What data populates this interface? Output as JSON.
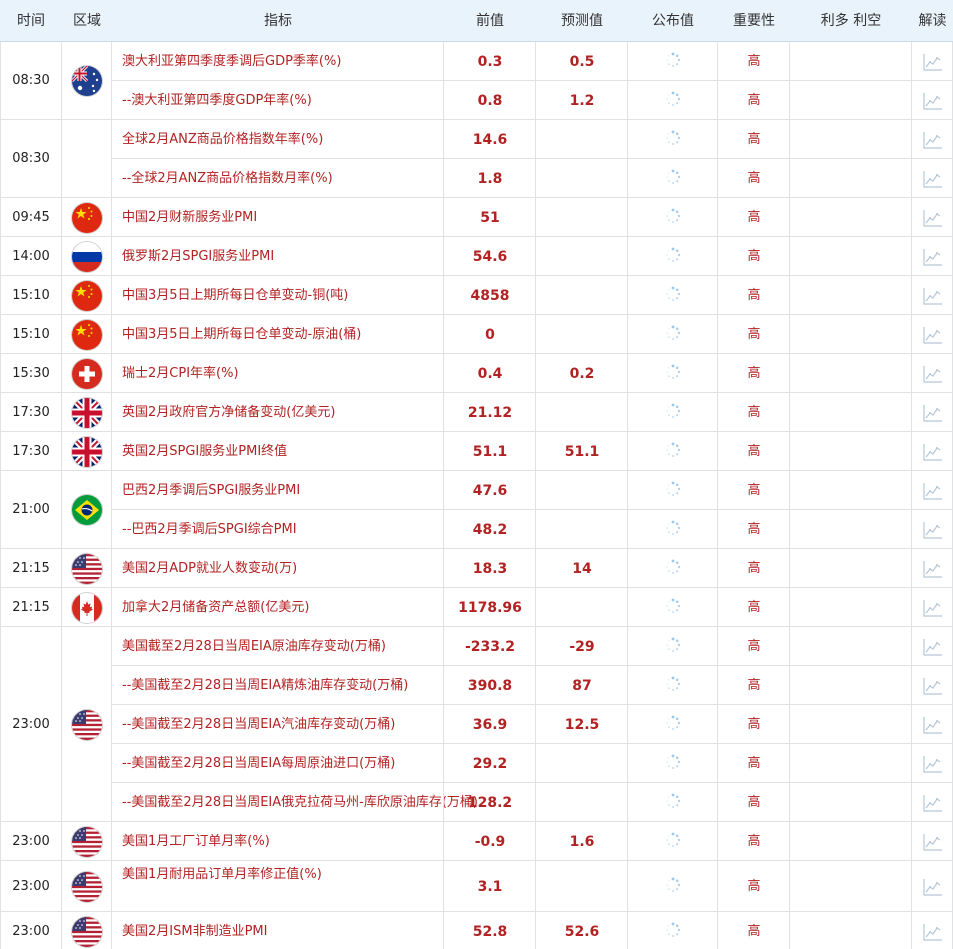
{
  "headers": {
    "time": "时间",
    "region": "区域",
    "indicator": "指标",
    "previous": "前值",
    "forecast": "预测值",
    "actual": "公布值",
    "importance": "重要性",
    "impact": "利多 利空",
    "analysis": "解读"
  },
  "colors": {
    "accent_red": "#b22222",
    "header_bg": "#e9f3fb",
    "grid": "#dfe1e3"
  },
  "groups": [
    {
      "time": "08:30",
      "flag": "australia-flag",
      "rows": [
        {
          "name": "澳大利亚第四季度季调后GDP季率(%)",
          "previous": "0.3",
          "forecast": "0.5",
          "importance": "高"
        },
        {
          "name": "--澳大利亚第四季度GDP年率(%)",
          "previous": "0.8",
          "forecast": "1.2",
          "importance": "高"
        }
      ]
    },
    {
      "time": "08:30",
      "flag": "",
      "rows": [
        {
          "name": "全球2月ANZ商品价格指数年率(%)",
          "previous": "14.6",
          "forecast": "",
          "importance": "高"
        },
        {
          "name": "--全球2月ANZ商品价格指数月率(%)",
          "previous": "1.8",
          "forecast": "",
          "importance": "高"
        }
      ]
    },
    {
      "time": "09:45",
      "flag": "china-flag",
      "rows": [
        {
          "name": "中国2月财新服务业PMI",
          "previous": "51",
          "forecast": "",
          "importance": "高"
        }
      ]
    },
    {
      "time": "14:00",
      "flag": "russia-flag",
      "rows": [
        {
          "name": "俄罗斯2月SPGI服务业PMI",
          "previous": "54.6",
          "forecast": "",
          "importance": "高"
        }
      ]
    },
    {
      "time": "15:10",
      "flag": "china-flag",
      "rows": [
        {
          "name": "中国3月5日上期所每日仓单变动-铜(吨)",
          "previous": "4858",
          "forecast": "",
          "importance": "高"
        }
      ]
    },
    {
      "time": "15:10",
      "flag": "china-flag",
      "rows": [
        {
          "name": "中国3月5日上期所每日仓单变动-原油(桶)",
          "previous": "0",
          "forecast": "",
          "importance": "高"
        }
      ]
    },
    {
      "time": "15:30",
      "flag": "switzerland-flag",
      "rows": [
        {
          "name": "瑞士2月CPI年率(%)",
          "previous": "0.4",
          "forecast": "0.2",
          "importance": "高"
        }
      ]
    },
    {
      "time": "17:30",
      "flag": "uk-flag",
      "rows": [
        {
          "name": "英国2月政府官方净储备变动(亿美元)",
          "previous": "21.12",
          "forecast": "",
          "importance": "高"
        }
      ]
    },
    {
      "time": "17:30",
      "flag": "uk-flag",
      "rows": [
        {
          "name": "英国2月SPGI服务业PMI终值",
          "previous": "51.1",
          "forecast": "51.1",
          "importance": "高"
        }
      ]
    },
    {
      "time": "21:00",
      "flag": "brazil-flag",
      "rows": [
        {
          "name": "巴西2月季调后SPGI服务业PMI",
          "previous": "47.6",
          "forecast": "",
          "importance": "高"
        },
        {
          "name": "--巴西2月季调后SPGI综合PMI",
          "previous": "48.2",
          "forecast": "",
          "importance": "高"
        }
      ]
    },
    {
      "time": "21:15",
      "flag": "us-flag",
      "rows": [
        {
          "name": "美国2月ADP就业人数变动(万)",
          "previous": "18.3",
          "forecast": "14",
          "importance": "高"
        }
      ]
    },
    {
      "time": "21:15",
      "flag": "canada-flag",
      "rows": [
        {
          "name": "加拿大2月储备资产总额(亿美元)",
          "previous": "1178.96",
          "forecast": "",
          "importance": "高"
        }
      ]
    },
    {
      "time": "23:00",
      "flag": "us-flag",
      "rows": [
        {
          "name": "美国截至2月28日当周EIA原油库存变动(万桶)",
          "previous": "-233.2",
          "forecast": "-29",
          "importance": "高"
        },
        {
          "name": "--美国截至2月28日当周EIA精炼油库存变动(万桶)",
          "previous": "390.8",
          "forecast": "87",
          "importance": "高"
        },
        {
          "name": "--美国截至2月28日当周EIA汽油库存变动(万桶)",
          "previous": "36.9",
          "forecast": "12.5",
          "importance": "高"
        },
        {
          "name": "--美国截至2月28日当周EIA每周原油进口(万桶)",
          "previous": "29.2",
          "forecast": "",
          "importance": "高"
        },
        {
          "name": "--美国截至2月28日当周EIA俄克拉荷马州-库欣原油库存(万桶)",
          "previous": "128.2",
          "forecast": "",
          "importance": "高"
        }
      ]
    },
    {
      "time": "23:00",
      "flag": "us-flag",
      "rows": [
        {
          "name": "美国1月工厂订单月率(%)",
          "previous": "-0.9",
          "forecast": "1.6",
          "importance": "高"
        }
      ]
    },
    {
      "time": "23:00",
      "flag": "us-flag",
      "rows": [
        {
          "name": "美国1月耐用品订单月率修正值(%)",
          "previous": "3.1",
          "forecast": "",
          "importance": "高"
        }
      ]
    },
    {
      "time": "23:00",
      "flag": "us-flag",
      "rows": [
        {
          "name": "美国2月ISM非制造业PMI",
          "previous": "52.8",
          "forecast": "52.6",
          "importance": "高"
        }
      ]
    }
  ]
}
